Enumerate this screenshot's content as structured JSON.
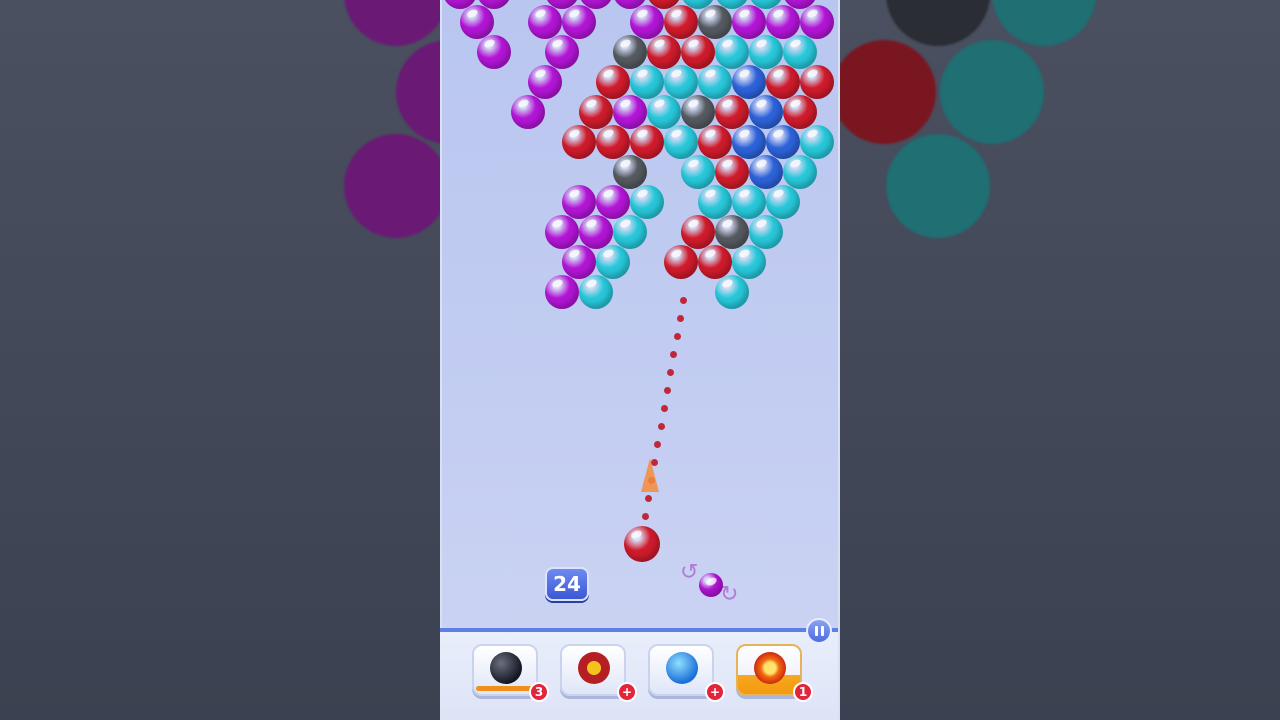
{
  "moves_left": "24",
  "boosters": [
    {
      "name": "bomb",
      "count": "3"
    },
    {
      "name": "nuke",
      "count": "+"
    },
    {
      "name": "lightning",
      "count": "+"
    },
    {
      "name": "fireball",
      "count": "1"
    }
  ],
  "colors": {
    "purple": "#b315d6",
    "red": "#cf1b2c",
    "cyan": "#27c7d9",
    "blue": "#2d62d9",
    "gray": "#555a60",
    "accent": "#5f7fe6"
  },
  "icons": [
    "pause-icon",
    "bomb-icon",
    "nuke-icon",
    "lightning-icon",
    "fireball-icon",
    "swap-icon"
  ]
}
